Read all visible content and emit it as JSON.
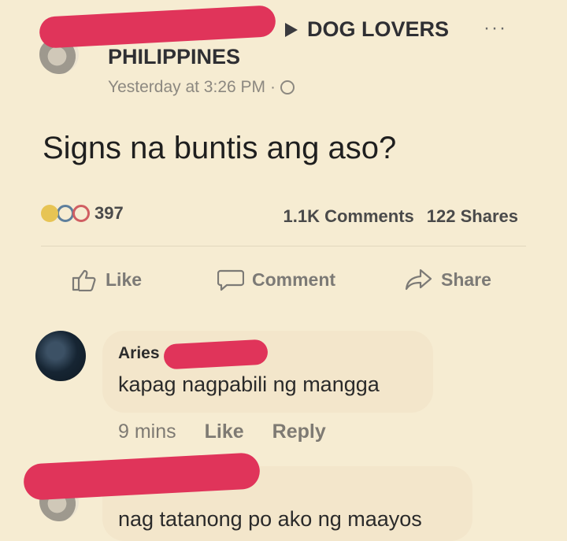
{
  "post": {
    "group_name_line1": "DOG LOVERS",
    "group_name_line2": "PHILIPPINES",
    "more_label": "···",
    "timestamp": "Yesterday at 3:26 PM",
    "timestamp_sep": "·",
    "text": "Signs na buntis ang aso?",
    "reaction_count": "397",
    "comments_count": "1.1K Comments",
    "shares_count": "122 Shares"
  },
  "actions": {
    "like": "Like",
    "comment": "Comment",
    "share": "Share"
  },
  "comments": [
    {
      "author": "Aries",
      "text": "kapag nagpabili ng mangga",
      "time": "9 mins",
      "like": "Like",
      "reply": "Reply"
    },
    {
      "text": "nag tatanong po ako ng maayos"
    }
  ],
  "colors": {
    "background": "#f6ecd2",
    "redaction": "#e0345a"
  }
}
